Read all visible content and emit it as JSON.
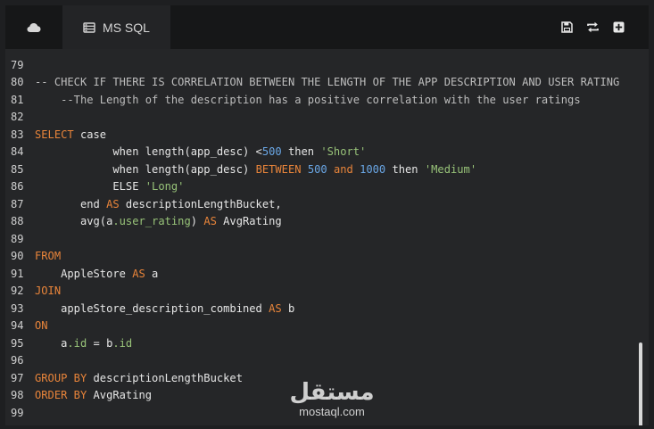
{
  "tabs": {
    "cloud_icon": "cloud-icon",
    "active_icon": "database-icon",
    "active_label": "MS SQL"
  },
  "toolbar": {
    "save_icon": "floppy-disk-icon",
    "swap_icon": "swap-arrows-icon",
    "add_icon": "plus-square-icon"
  },
  "editor": {
    "lines": [
      {
        "n": "79",
        "tokens": []
      },
      {
        "n": "80",
        "tokens": [
          [
            "cm",
            "-- CHECK IF THERE IS CORRELATION BETWEEN THE LENGTH OF THE APP DESCRIPTION AND USER RATING"
          ]
        ]
      },
      {
        "n": "81",
        "tokens": [
          [
            "cm",
            "    --The Length of the description has a positive correlation with the user ratings"
          ]
        ]
      },
      {
        "n": "82",
        "tokens": []
      },
      {
        "n": "83",
        "tokens": [
          [
            "kw",
            "SELECT"
          ],
          [
            "tx",
            " case"
          ]
        ]
      },
      {
        "n": "84",
        "tokens": [
          [
            "tx",
            "            when length(app_desc) <"
          ],
          [
            "nm",
            "500"
          ],
          [
            "tx",
            " then "
          ],
          [
            "st",
            "'Short'"
          ]
        ]
      },
      {
        "n": "85",
        "tokens": [
          [
            "tx",
            "            when length(app_desc) "
          ],
          [
            "kw",
            "BETWEEN"
          ],
          [
            "tx",
            " "
          ],
          [
            "nm",
            "500"
          ],
          [
            "tx",
            " "
          ],
          [
            "kw",
            "and"
          ],
          [
            "tx",
            " "
          ],
          [
            "nm",
            "1000"
          ],
          [
            "tx",
            " then "
          ],
          [
            "st",
            "'Medium'"
          ]
        ]
      },
      {
        "n": "86",
        "tokens": [
          [
            "tx",
            "            ELSE "
          ],
          [
            "st",
            "'Long'"
          ]
        ]
      },
      {
        "n": "87",
        "tokens": [
          [
            "tx",
            "       end "
          ],
          [
            "kw",
            "AS"
          ],
          [
            "tx",
            " descriptionLengthBucket,"
          ]
        ]
      },
      {
        "n": "88",
        "tokens": [
          [
            "tx",
            "       avg(a"
          ],
          [
            "id",
            ".user_rating"
          ],
          [
            "tx",
            ") "
          ],
          [
            "kw",
            "AS"
          ],
          [
            "tx",
            " AvgRating"
          ]
        ]
      },
      {
        "n": "89",
        "tokens": []
      },
      {
        "n": "90",
        "tokens": [
          [
            "kw",
            "FROM"
          ]
        ]
      },
      {
        "n": "91",
        "tokens": [
          [
            "tx",
            "    AppleStore "
          ],
          [
            "kw",
            "AS"
          ],
          [
            "tx",
            " a"
          ]
        ]
      },
      {
        "n": "92",
        "tokens": [
          [
            "kw",
            "JOIN"
          ]
        ]
      },
      {
        "n": "93",
        "tokens": [
          [
            "tx",
            "    appleStore_description_combined "
          ],
          [
            "kw",
            "AS"
          ],
          [
            "tx",
            " b"
          ]
        ]
      },
      {
        "n": "94",
        "tokens": [
          [
            "kw",
            "ON"
          ]
        ]
      },
      {
        "n": "95",
        "tokens": [
          [
            "tx",
            "    a"
          ],
          [
            "id",
            ".id"
          ],
          [
            "tx",
            " = b"
          ],
          [
            "id",
            ".id"
          ]
        ]
      },
      {
        "n": "96",
        "tokens": []
      },
      {
        "n": "97",
        "tokens": [
          [
            "kw",
            "GROUP BY"
          ],
          [
            "tx",
            " descriptionLengthBucket"
          ]
        ]
      },
      {
        "n": "98",
        "tokens": [
          [
            "kw",
            "ORDER BY"
          ],
          [
            "tx",
            " AvgRating"
          ]
        ]
      },
      {
        "n": "99",
        "tokens": []
      }
    ]
  },
  "watermark": {
    "arabic": "مستقل",
    "latin": "mostaql.com"
  },
  "colors": {
    "keyword": "#e8843a",
    "number": "#6aa7e6",
    "string": "#98c379",
    "comment": "#bdbdbd",
    "background": "#252628"
  }
}
